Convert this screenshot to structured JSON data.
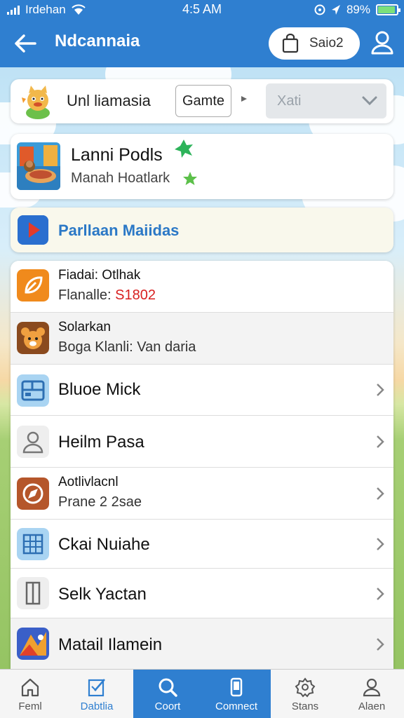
{
  "status_bar": {
    "carrier": "Irdehan",
    "time": "4:5 AM",
    "battery": "89%"
  },
  "app_bar": {
    "title": "Ndcannaia",
    "pill_label": "Saio2"
  },
  "filter_row": {
    "label": "Unl liamasia",
    "game_button": "Gamte",
    "select_value": "Xati"
  },
  "feature_card": {
    "title": "Lanni Podls",
    "subtitle": "Manah Hoatlark"
  },
  "promo_row": {
    "label": "Parllaan Maiidas"
  },
  "list_items": [
    {
      "line1": "Fiadai: Otlhak",
      "line2_prefix": "Flanalle: ",
      "line2_value": "S1802",
      "icon": "leaf-icon"
    },
    {
      "line1": "Solarkan",
      "line2": "Boga Klanli: Van daria",
      "icon": "bear-icon"
    },
    {
      "label": "Bluoe Mick",
      "icon": "dashboard-icon"
    },
    {
      "label": "Heilm Pasa",
      "icon": "user-icon"
    },
    {
      "line1": "Aotlivlacnl",
      "line2": "Prane 2 2sae",
      "icon": "compass-icon"
    },
    {
      "label": "Ckai Nuiahe",
      "icon": "calculator-icon"
    },
    {
      "label": "Selk Yactan",
      "icon": "door-icon"
    },
    {
      "label": "Matail Ilamein",
      "icon": "game-art-icon"
    }
  ],
  "bottom_nav": [
    {
      "label": "Feml",
      "icon": "home-icon"
    },
    {
      "label": "Dabtlia",
      "icon": "edit-icon"
    },
    {
      "label": "Coort",
      "icon": "search-icon"
    },
    {
      "label": "Comnect",
      "icon": "phone-icon"
    },
    {
      "label": "Stans",
      "icon": "gear-icon"
    },
    {
      "label": "Alaen",
      "icon": "profile-icon"
    }
  ],
  "colors": {
    "brand_blue": "#2f7fd0",
    "accent_red": "#d82020"
  }
}
